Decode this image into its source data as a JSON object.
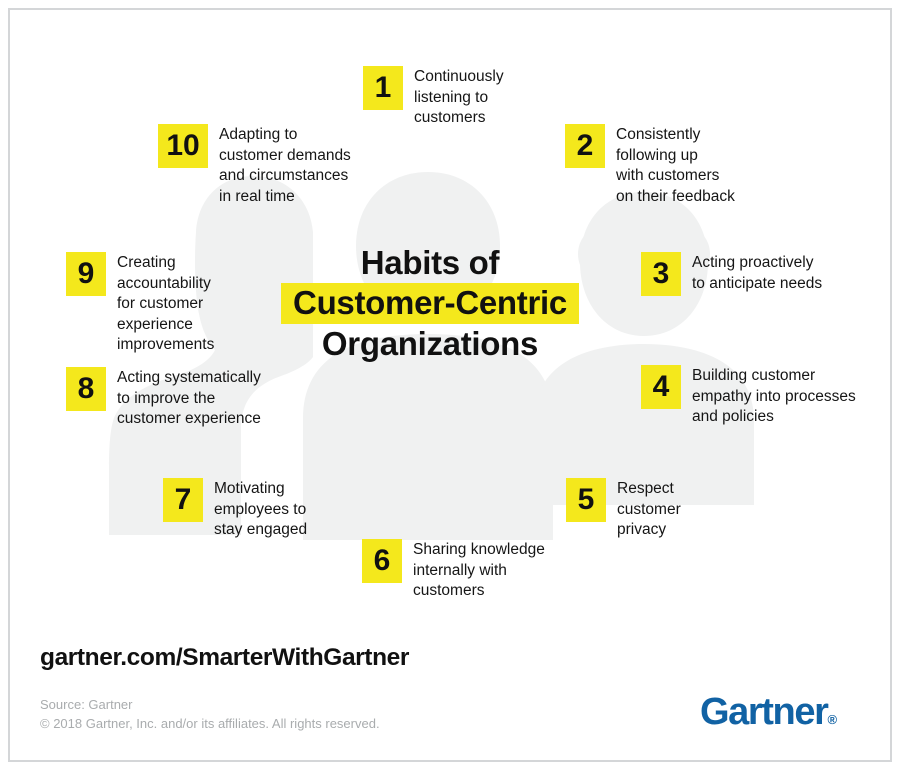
{
  "colors": {
    "accent_yellow": "#F4E81C",
    "text_dark": "#151515",
    "silhouette_gray": "#F0F1F1",
    "frame_gray": "#D4D6D8",
    "source_gray": "#A9ACAE",
    "brand_blue": "#1162A4"
  },
  "title": {
    "line1": "Habits of",
    "line2": "Customer-Centric",
    "line3": "Organizations"
  },
  "habits": [
    {
      "number": "1",
      "text": "Continuously\nlistening to\ncustomers"
    },
    {
      "number": "2",
      "text": "Consistently\nfollowing up\nwith customers\non their feedback"
    },
    {
      "number": "3",
      "text": "Acting proactively\nto anticipate needs"
    },
    {
      "number": "4",
      "text": "Building customer\nempathy into processes\nand policies"
    },
    {
      "number": "5",
      "text": "Respect\ncustomer\nprivacy"
    },
    {
      "number": "6",
      "text": "Sharing knowledge\ninternally with\ncustomers"
    },
    {
      "number": "7",
      "text": "Motivating\nemployees to\nstay engaged"
    },
    {
      "number": "8",
      "text": "Acting systematically\nto improve the\ncustomer experience"
    },
    {
      "number": "9",
      "text": "Creating\naccountability\nfor customer\nexperience\nimprovements"
    },
    {
      "number": "10",
      "text": "Adapting to\ncustomer demands\nand circumstances\nin real time"
    }
  ],
  "footer": {
    "site_url": "gartner.com/SmarterWithGartner",
    "source": "Source: Gartner\n© 2018 Gartner, Inc. and/or its affiliates. All rights reserved.",
    "logo_name": "Gartner",
    "logo_mark": "®"
  },
  "background": {
    "figure_left": "person-silhouette-long-hair",
    "figure_center": "person-silhouette-short-hair",
    "figure_right": "person-silhouette-bald"
  }
}
